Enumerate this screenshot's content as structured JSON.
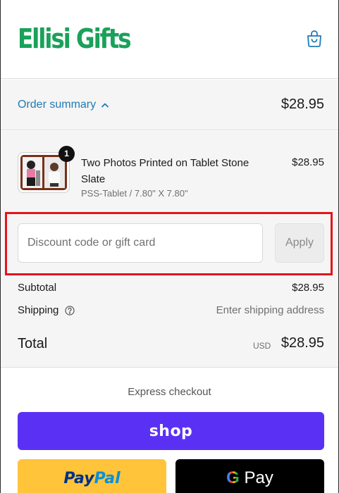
{
  "brand": {
    "name": "Ellisi Gifts",
    "color": "#1aa15a"
  },
  "header": {
    "cart_icon": "shopping-bag-icon"
  },
  "summary": {
    "label": "Order summary",
    "toggle_icon": "chevron-up-icon",
    "total": "$28.95"
  },
  "item": {
    "name": "Two Photos Printed on Tablet Stone Slate",
    "variant": "PSS-Tablet / 7.80\" X 7.80\"",
    "price": "$28.95",
    "quantity": "1"
  },
  "discount": {
    "placeholder": "Discount code or gift card",
    "apply_label": "Apply"
  },
  "totals": {
    "subtotal_label": "Subtotal",
    "subtotal_value": "$28.95",
    "shipping_label": "Shipping",
    "shipping_value": "Enter shipping address",
    "total_label": "Total",
    "currency": "USD",
    "total_value": "$28.95"
  },
  "express": {
    "heading": "Express checkout",
    "shop_label": "shop",
    "paypal_part1": "Pay",
    "paypal_part2": "Pal",
    "gpay_g": "G",
    "gpay_pay": "Pay"
  },
  "colors": {
    "accent_link": "#1f7ab5",
    "shop": "#5a31f4",
    "paypal": "#ffc439",
    "gpay": "#000000",
    "highlight": "#e3141c"
  }
}
